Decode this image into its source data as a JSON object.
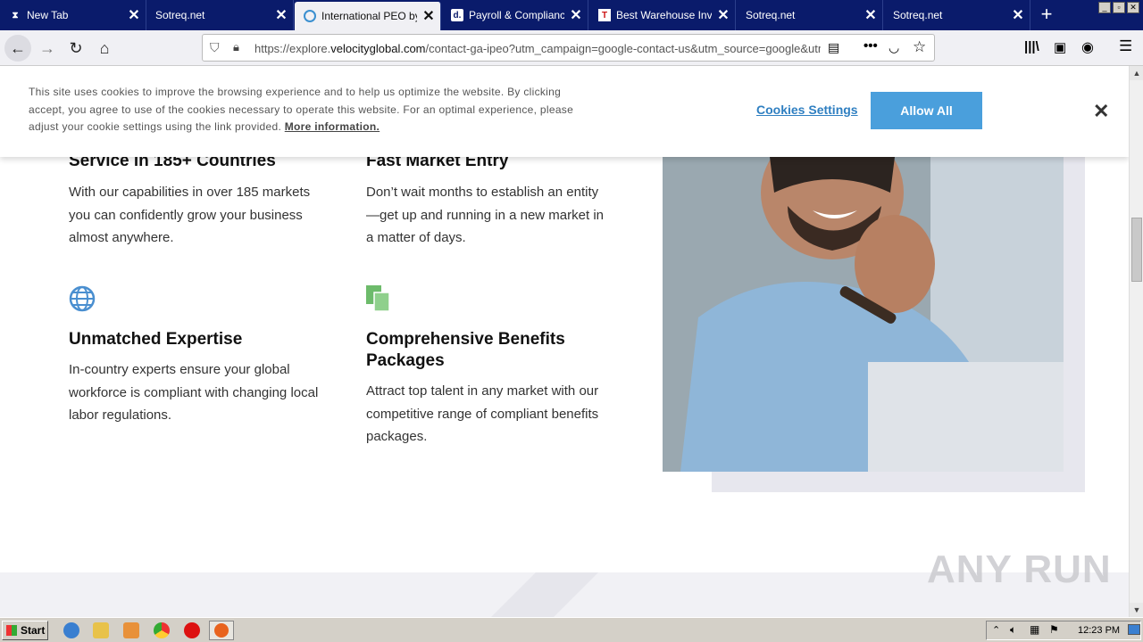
{
  "tabs": [
    {
      "label": "New Tab",
      "icon": "hourglass-icon"
    },
    {
      "label": "Sotreq.net",
      "icon": ""
    },
    {
      "label": "International PEO by V",
      "icon": "velocity-icon"
    },
    {
      "label": "Payroll & Compliance f",
      "icon": "d-icon"
    },
    {
      "label": "Best Warehouse Inven",
      "icon": "t-icon"
    },
    {
      "label": "Sotreq.net",
      "icon": ""
    },
    {
      "label": "Sotreq.net",
      "icon": ""
    }
  ],
  "new_tab_label": "+",
  "window_buttons": [
    "_",
    "▫",
    "✕"
  ],
  "address": {
    "prefix": "https://explore.",
    "domain": "velocityglobal.com",
    "suffix": "/contact-ga-ipeo?utm_campaign=google-contact-us&utm_source=google&utm"
  },
  "features": [
    {
      "title": "Service in 185+ Countries",
      "body": "With our capabilities in over 185 markets you can confidently grow your business almost anywhere."
    },
    {
      "title": "Fast Market Entry",
      "body": "Don’t wait months to establish an entity—get up and running in a new market in a matter of days."
    },
    {
      "title": "Unmatched Expertise",
      "body": "In-country experts ensure your global workforce is compliant with changing local labor regulations."
    },
    {
      "title": "Comprehensive Benefits Packages",
      "body": "Attract top talent in any market with our competitive range of compliant benefits packages."
    }
  ],
  "colors": {
    "globe_icon": "#4a8fd0",
    "docs_icon": "#6dbb6b",
    "allow_button": "#4a9fdc",
    "tabbar": "#0a1b6b"
  },
  "cookie": {
    "text": "This site uses cookies to improve the browsing experience and to help us optimize the website. By clicking accept, you agree to use of the cookies necessary to operate this website. For an optimal experience, please adjust your cookie settings using the link provided. ",
    "link": "More information.",
    "settings": "Cookies Settings",
    "allow": "Allow All",
    "close": "✕"
  },
  "watermark": "ANY RUN",
  "taskbar": {
    "start": "Start",
    "clock": "12:23 PM"
  }
}
